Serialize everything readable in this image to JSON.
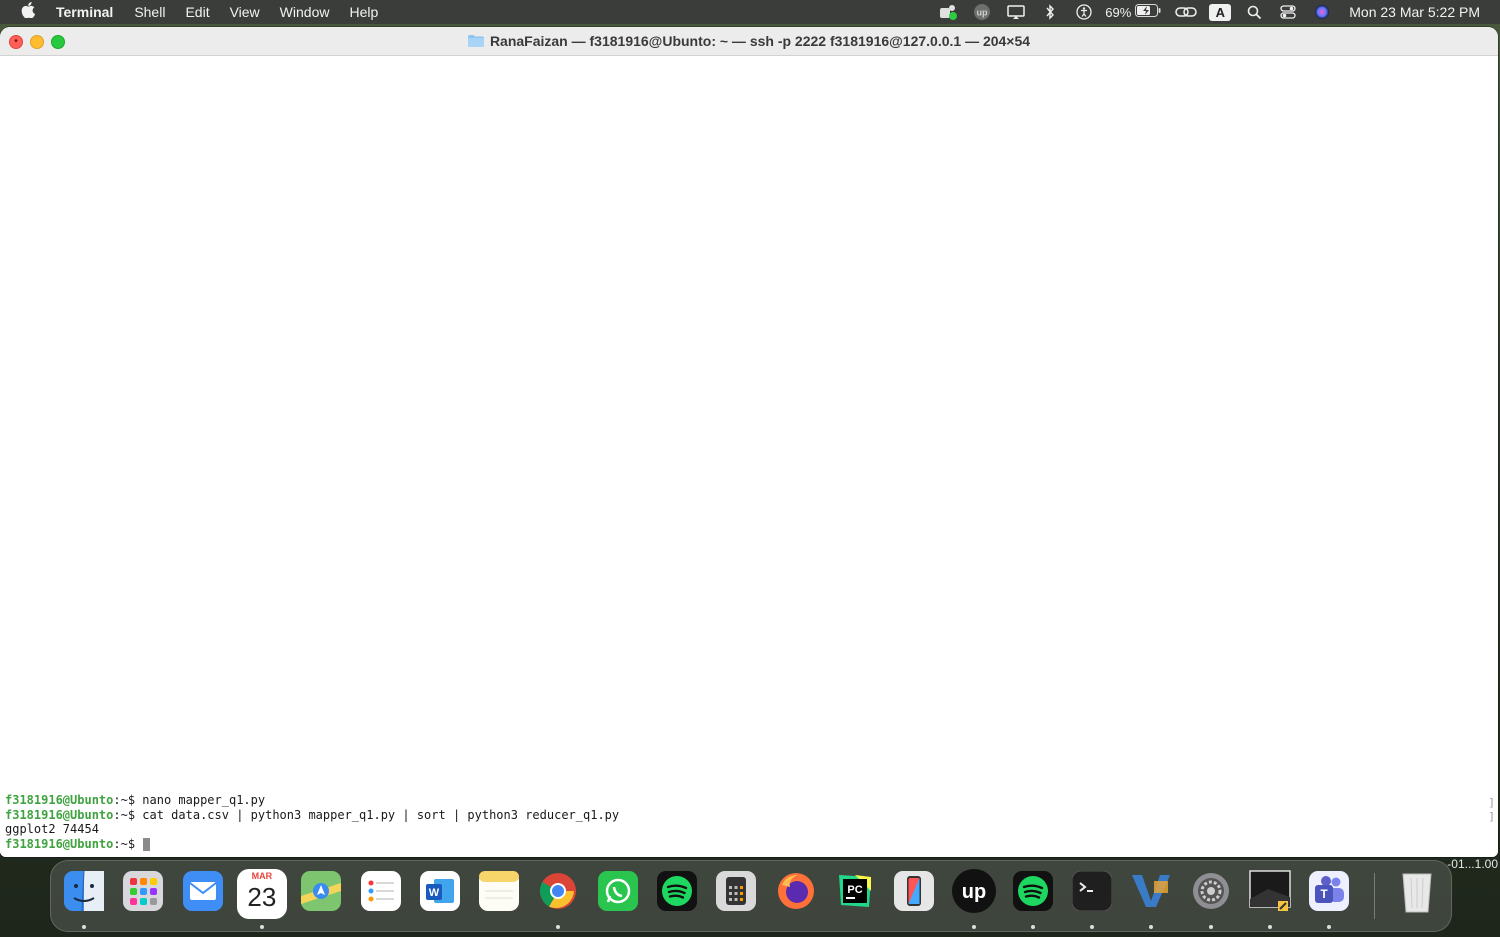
{
  "menubar": {
    "apple_icon": "apple-icon",
    "app_name": "Terminal",
    "menus": [
      "Shell",
      "Edit",
      "View",
      "Window",
      "Help"
    ],
    "status_icons": [
      "teams-status-icon",
      "upwork-status-icon",
      "display-icon",
      "bluetooth-icon",
      "accessibility-icon"
    ],
    "battery_percent": "69%",
    "input_source": "A",
    "clock": "Mon 23 Mar  5:22 PM"
  },
  "window": {
    "title": "RanaFaizan — f3181916@Ubunto: ~ — ssh -p 2222 f3181916@127.0.0.1 — 204×54",
    "terminal": {
      "lines": [
        {
          "user": "f3181916@Ubunto",
          "path": ":~$",
          "command": " nano mapper_q1.py"
        },
        {
          "user": "f3181916@Ubunto",
          "path": ":~$",
          "command": " cat data.csv | python3 mapper_q1.py | sort | python3 reducer_q1.py"
        },
        {
          "output": "ggplot2 74454"
        },
        {
          "user": "f3181916@Ubunto",
          "path": ":~$",
          "command": " "
        }
      ]
    }
  },
  "dock": {
    "apps": [
      {
        "name": "Finder",
        "icon": "finder-icon",
        "color": "#3b8ef0",
        "running": true
      },
      {
        "name": "Launchpad",
        "icon": "launchpad-icon",
        "color": "#d8d8dc",
        "running": false
      },
      {
        "name": "Mail",
        "icon": "mail-icon",
        "color": "#3f8ef5",
        "running": false
      },
      {
        "name": "Calendar",
        "icon": "calendar-icon",
        "color": "#ffffff",
        "running": true
      },
      {
        "name": "Maps",
        "icon": "maps-icon",
        "color": "#7ec56f",
        "running": false
      },
      {
        "name": "Reminders",
        "icon": "reminders-icon",
        "color": "#ffffff",
        "running": false
      },
      {
        "name": "Word",
        "icon": "word-icon",
        "color": "#2b5fb8",
        "running": false
      },
      {
        "name": "Notes",
        "icon": "notes-icon",
        "color": "#f7d56a",
        "running": false
      },
      {
        "name": "Chrome",
        "icon": "chrome-icon",
        "color": "#e9e9e9",
        "running": true
      },
      {
        "name": "WhatsApp",
        "icon": "whatsapp-icon",
        "color": "#29c54e",
        "running": false
      },
      {
        "name": "Spotify",
        "icon": "spotify-icon",
        "color": "#111111",
        "running": false
      },
      {
        "name": "Calculator",
        "icon": "calculator-icon",
        "color": "#d9d9d9",
        "running": false
      },
      {
        "name": "Firefox",
        "icon": "firefox-icon",
        "color": "#5a2bb0",
        "running": false
      },
      {
        "name": "PyCharm",
        "icon": "pycharm-icon",
        "color": "#21d789",
        "running": false
      },
      {
        "name": "iPhone Mirroring",
        "icon": "iphone-mirroring-icon",
        "color": "#dcdcdc",
        "running": false
      },
      {
        "name": "Upwork",
        "icon": "upwork-icon",
        "color": "#111111",
        "running": true
      },
      {
        "name": "Spotify",
        "icon": "spotify-icon",
        "color": "#111111",
        "running": true
      },
      {
        "name": "Terminal",
        "icon": "terminal-icon",
        "color": "#1f1f1f",
        "running": true
      },
      {
        "name": "VS Code",
        "icon": "vscode-icon",
        "color": "#3a7bc8",
        "running": true
      },
      {
        "name": "System Settings",
        "icon": "settings-icon",
        "color": "#8e8e93",
        "running": true
      },
      {
        "name": "Preview",
        "icon": "preview-icon",
        "color": "#1a1a1a",
        "running": true
      },
      {
        "name": "Teams",
        "icon": "teams-icon",
        "color": "#5b5fc7",
        "running": true
      }
    ],
    "trash": {
      "name": "Trash",
      "icon": "trash-icon",
      "color": "#d6d6d6"
    },
    "calendar_month": "MAR",
    "calendar_day": "23"
  },
  "desktop": {
    "overlay_text": "-01...1.00"
  },
  "colors": {
    "prompt_user": "#3fa33f",
    "close": "#fe5f57",
    "minimize": "#febc2e",
    "maximize": "#28c840"
  }
}
